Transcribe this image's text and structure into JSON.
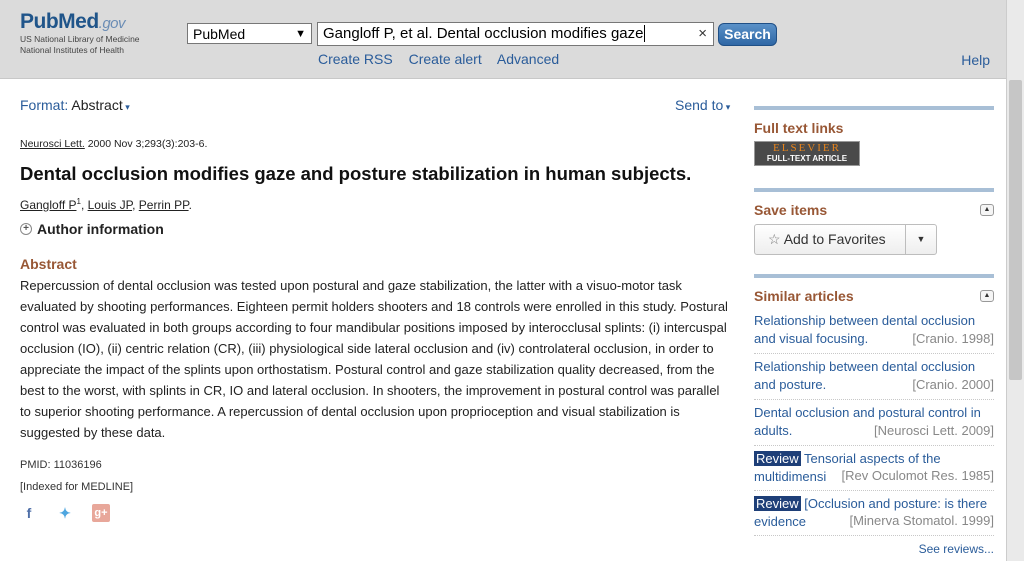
{
  "header": {
    "logo_brand": "PubMed",
    "logo_gov": ".gov",
    "logo_line1": "US National Library of Medicine",
    "logo_line2": "National Institutes of Health",
    "db_select": "PubMed",
    "search_value": "Gangloff P, et al. Dental occlusion modifies gaze",
    "clear_icon": "×",
    "search_button": "Search",
    "links": [
      "Create RSS",
      "Create alert",
      "Advanced"
    ],
    "help": "Help"
  },
  "main": {
    "format_label": "Format:",
    "format_value": "Abstract",
    "send_to": "Send to",
    "citation_journal": "Neurosci Lett.",
    "citation_rest": " 2000 Nov 3;293(3):203-6.",
    "title": "Dental occlusion modifies gaze and posture stabilization in human subjects.",
    "authors": [
      "Gangloff P",
      "Louis JP",
      "Perrin PP"
    ],
    "author_sup": "1",
    "author_info": "Author information",
    "abstract_heading": "Abstract",
    "abstract_text": "Repercussion of dental occlusion was tested upon postural and gaze stabilization, the latter with a visuo-motor task evaluated by shooting performances. Eighteen permit holders shooters and 18 controls were enrolled in this study. Postural control was evaluated in both groups according to four mandibular positions imposed by interocclusal splints: (i) intercuspal occlusion (IO), (ii) centric relation (CR), (iii) physiological side lateral occlusion and (iv) controlateral occlusion, in order to appreciate the impact of the splints upon orthostatism. Postural control and gaze stabilization quality decreased, from the best to the worst, with splints in CR, IO and lateral occlusion. In shooters, the improvement in postural control was parallel to superior shooting performance. A repercussion of dental occlusion upon proprioception and visual stabilization is suggested by these data.",
    "pmid": "PMID: 11036196",
    "indexed": "[Indexed for MEDLINE]"
  },
  "sidebar": {
    "full_text_heading": "Full text links",
    "elsevier_top": "ELSEVIER",
    "elsevier_bottom": "FULL-TEXT ARTICLE",
    "save_items_heading": "Save items",
    "add_favorites": "Add to Favorites",
    "similar_heading": "Similar articles",
    "similar": [
      {
        "review": "",
        "title": "Relationship between dental occlusion and visual focusing.",
        "source": "[Cranio. 1998]"
      },
      {
        "review": "",
        "title": "Relationship between dental occlusion and posture.",
        "source": "[Cranio. 2000]"
      },
      {
        "review": "",
        "title": "Dental occlusion and postural control in adults.",
        "source": "[Neurosci Lett. 2009]"
      },
      {
        "review": "Review",
        "title": "Tensorial aspects of the multidimensi",
        "source": "[Rev Oculomot Res. 1985]"
      },
      {
        "review": "Review",
        "title": "[Occlusion and posture: is there evidence",
        "source": "[Minerva Stomatol. 1999]"
      }
    ],
    "see_reviews": "See reviews..."
  }
}
